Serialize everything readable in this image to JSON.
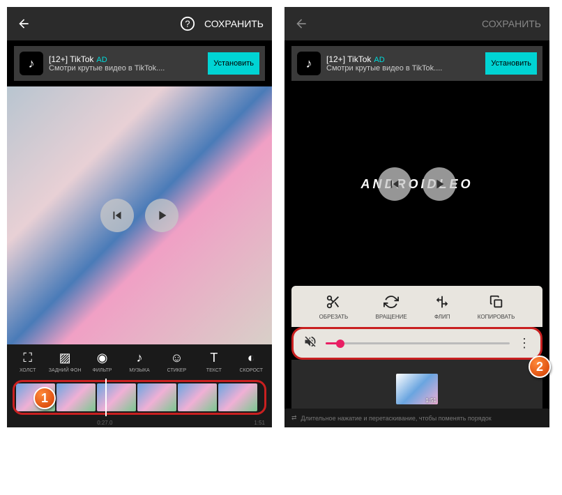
{
  "header": {
    "save_label": "СОХРАНИТЬ"
  },
  "ad": {
    "title": "[12+] TikTok",
    "badge": "AD",
    "subtitle": "Смотри крутые видео в TikTok....",
    "cta": "Установить",
    "icon_glyph": "♪"
  },
  "watermark": "ANDROIDLEO",
  "toolbar": [
    {
      "icon": "⛶",
      "label": "ХОЛСТ"
    },
    {
      "icon": "▨",
      "label": "ЗАДНИЙ ФОН"
    },
    {
      "icon": "◉",
      "label": "ФИЛЬТР"
    },
    {
      "icon": "♪",
      "label": "МУЗЫКА"
    },
    {
      "icon": "☺",
      "label": "СТИКЕР"
    },
    {
      "icon": "T",
      "label": "ТЕКСТ"
    },
    {
      "icon": "◐",
      "label": "СКОРОСТ"
    }
  ],
  "timeline": {
    "time_current": "0:27.0",
    "time_total": "1:51"
  },
  "edit_tools": [
    {
      "icon": "scissors",
      "label": "ОБРЕЗАТЬ"
    },
    {
      "icon": "rotate",
      "label": "ВРАЩЕНИЕ"
    },
    {
      "icon": "flip",
      "label": "ФЛИП"
    },
    {
      "icon": "copy",
      "label": "КОПИРОВАТЬ"
    }
  ],
  "clip": {
    "duration": "1:51"
  },
  "hint": "Длительное нажатие и перетаскивание, чтобы поменять порядок",
  "callouts": {
    "one": "1",
    "two": "2"
  }
}
